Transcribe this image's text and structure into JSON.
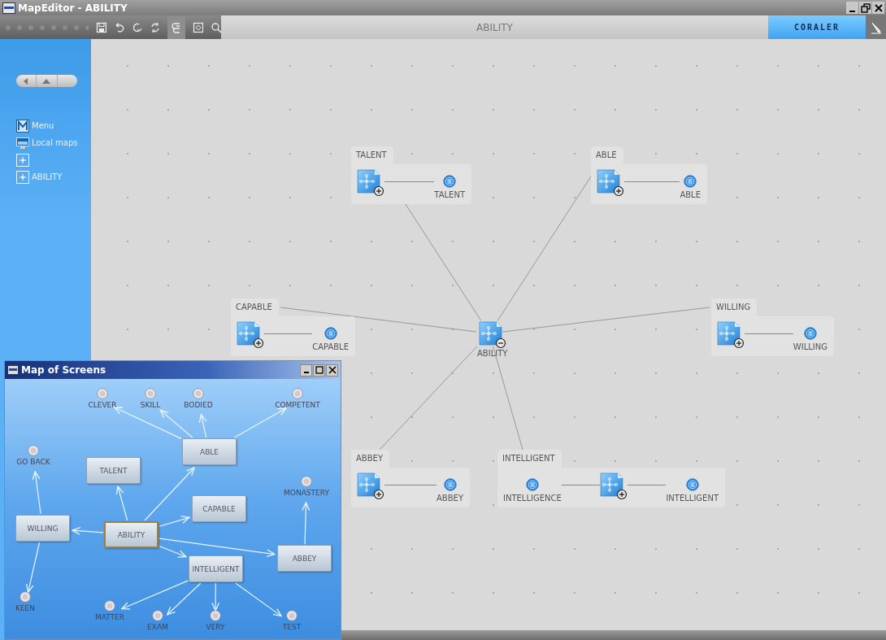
{
  "window": {
    "title": "MapEditor - ABILITY"
  },
  "toolbar": {
    "title": "ABILITY",
    "brand": "CORALER"
  },
  "sidebar": {
    "items": [
      {
        "kind": "menu",
        "label": "Menu"
      },
      {
        "kind": "monitor",
        "label": "Local maps"
      },
      {
        "kind": "map"
      },
      {
        "kind": "map",
        "label": "ABILITY"
      }
    ]
  },
  "canvas": {
    "center": {
      "label": "ABILITY",
      "expanded": true
    },
    "groups": [
      {
        "title": "TALENT",
        "items": [
          {
            "kind": "map",
            "expanded": false
          },
          {
            "kind": "screen",
            "label": "TALENT"
          }
        ]
      },
      {
        "title": "ABLE",
        "items": [
          {
            "kind": "map",
            "expanded": false
          },
          {
            "kind": "screen",
            "label": "ABLE"
          }
        ]
      },
      {
        "title": "CAPABLE",
        "items": [
          {
            "kind": "map",
            "expanded": false
          },
          {
            "kind": "screen",
            "label": "CAPABLE"
          }
        ]
      },
      {
        "title": "WILLING",
        "items": [
          {
            "kind": "map",
            "expanded": false
          },
          {
            "kind": "screen",
            "label": "WILLING"
          }
        ]
      },
      {
        "title": "ABBEY",
        "items": [
          {
            "kind": "map",
            "expanded": false
          },
          {
            "kind": "screen",
            "label": "ABBEY"
          }
        ]
      },
      {
        "title": "INTELLIGENT",
        "items": [
          {
            "kind": "screen",
            "label": "INTELLIGENCE"
          },
          {
            "kind": "map",
            "expanded": false
          },
          {
            "kind": "screen",
            "label": "INTELLIGENT"
          }
        ]
      }
    ]
  },
  "map_of_screens": {
    "title": "Map of Screens",
    "nodes": [
      {
        "kind": "action",
        "label": "CLEVER"
      },
      {
        "kind": "action",
        "label": "SKILL"
      },
      {
        "kind": "action",
        "label": "BODIED"
      },
      {
        "kind": "action",
        "label": "COMPETENT"
      },
      {
        "kind": "screen",
        "label": "ABLE",
        "selected": false
      },
      {
        "kind": "action",
        "label": "GO BACK"
      },
      {
        "kind": "screen",
        "label": "TALENT",
        "selected": false
      },
      {
        "kind": "action",
        "label": "MONASTERY"
      },
      {
        "kind": "screen",
        "label": "CAPABLE",
        "selected": false
      },
      {
        "kind": "screen",
        "label": "WILLING",
        "selected": false
      },
      {
        "kind": "screen",
        "label": "ABILITY",
        "selected": true
      },
      {
        "kind": "screen",
        "label": "ABBEY",
        "selected": false
      },
      {
        "kind": "screen",
        "label": "INTELLIGENT",
        "selected": false
      },
      {
        "kind": "action",
        "label": "KEEN"
      },
      {
        "kind": "action",
        "label": "MATTER"
      },
      {
        "kind": "action",
        "label": "EXAM"
      },
      {
        "kind": "action",
        "label": "VERY"
      },
      {
        "kind": "action",
        "label": "TEST"
      }
    ]
  }
}
